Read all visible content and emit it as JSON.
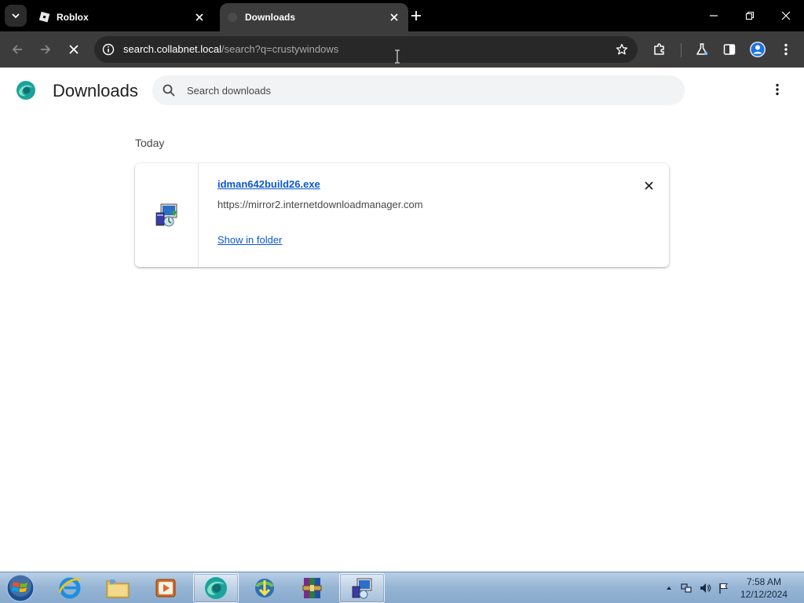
{
  "tabs": [
    {
      "title": "Roblox",
      "favicon": "roblox-icon",
      "active": false
    },
    {
      "title": "Downloads",
      "favicon": "downloads-icon",
      "active": true
    }
  ],
  "omnibox": {
    "host": "search.collabnet.local",
    "path": "/search?q=crustywindows"
  },
  "page": {
    "title": "Downloads",
    "search_placeholder": "Search downloads",
    "date_group": "Today",
    "items": [
      {
        "file_name": "idman642build26.exe",
        "source_url": "https://mirror2.internetdownloadmanager.com",
        "action_label": "Show in folder"
      }
    ]
  },
  "taskbar": {
    "apps": [
      "internet-explorer-icon",
      "file-explorer-icon",
      "media-player-icon",
      "browser-icon",
      "idm-icon",
      "winrar-icon",
      "setup-icon"
    ],
    "clock_time": "7:58 AM",
    "clock_date": "12/12/2024"
  },
  "colors": {
    "tabstrip_bg": "#000000",
    "toolbar_bg": "#3c3c3c",
    "omnibox_bg": "#282828",
    "link_blue": "#0b57d0",
    "search_bg": "#f1f3f4"
  }
}
